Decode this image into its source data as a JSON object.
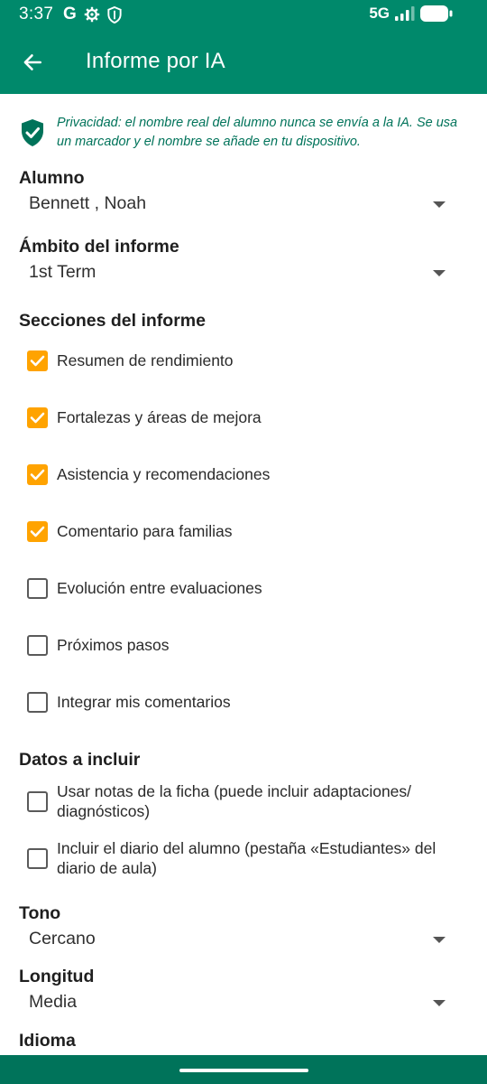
{
  "status_bar": {
    "time": "3:37",
    "google_glyph": "G",
    "network": "5G",
    "icons": [
      "google-icon",
      "settings-icon",
      "shield-icon",
      "signal-icon",
      "battery-icon"
    ]
  },
  "app_bar": {
    "title": "Informe por IA",
    "back_icon": "arrow-left-icon"
  },
  "privacy": {
    "text": "Privacidad: el nombre real del alumno nunca se envía a la IA. Se usa un marcador y el nombre se añade en tu dispositivo.",
    "icon": "shield-check-icon"
  },
  "fields": {
    "student": {
      "label": "Alumno",
      "value": "Bennett , Noah"
    },
    "scope": {
      "label": "Ámbito del informe",
      "value": "1st Term"
    },
    "tone": {
      "label": "Tono",
      "value": "Cercano"
    },
    "length": {
      "label": "Longitud",
      "value": "Media"
    },
    "language": {
      "label": "Idioma"
    }
  },
  "sections": {
    "title": "Secciones del informe",
    "items": [
      {
        "label": "Resumen de rendimiento",
        "checked": true
      },
      {
        "label": "Fortalezas y áreas de mejora",
        "checked": true
      },
      {
        "label": "Asistencia y recomendaciones",
        "checked": true
      },
      {
        "label": "Comentario para familias",
        "checked": true
      },
      {
        "label": "Evolución entre evaluaciones",
        "checked": false
      },
      {
        "label": "Próximos pasos",
        "checked": false
      },
      {
        "label": "Integrar mis comentarios",
        "checked": false
      }
    ]
  },
  "data_include": {
    "title": "Datos a incluir",
    "items": [
      {
        "label": "Usar notas de la ficha (puede incluir adaptaciones/ diagnósticos)",
        "checked": false
      },
      {
        "label": "Incluir el diario del alumno (pestaña «Estudiantes» del diario de aula)",
        "checked": false
      }
    ]
  },
  "colors": {
    "primary": "#00896b",
    "primary_dark": "#00735a",
    "checkbox_accent": "#ffa300"
  }
}
